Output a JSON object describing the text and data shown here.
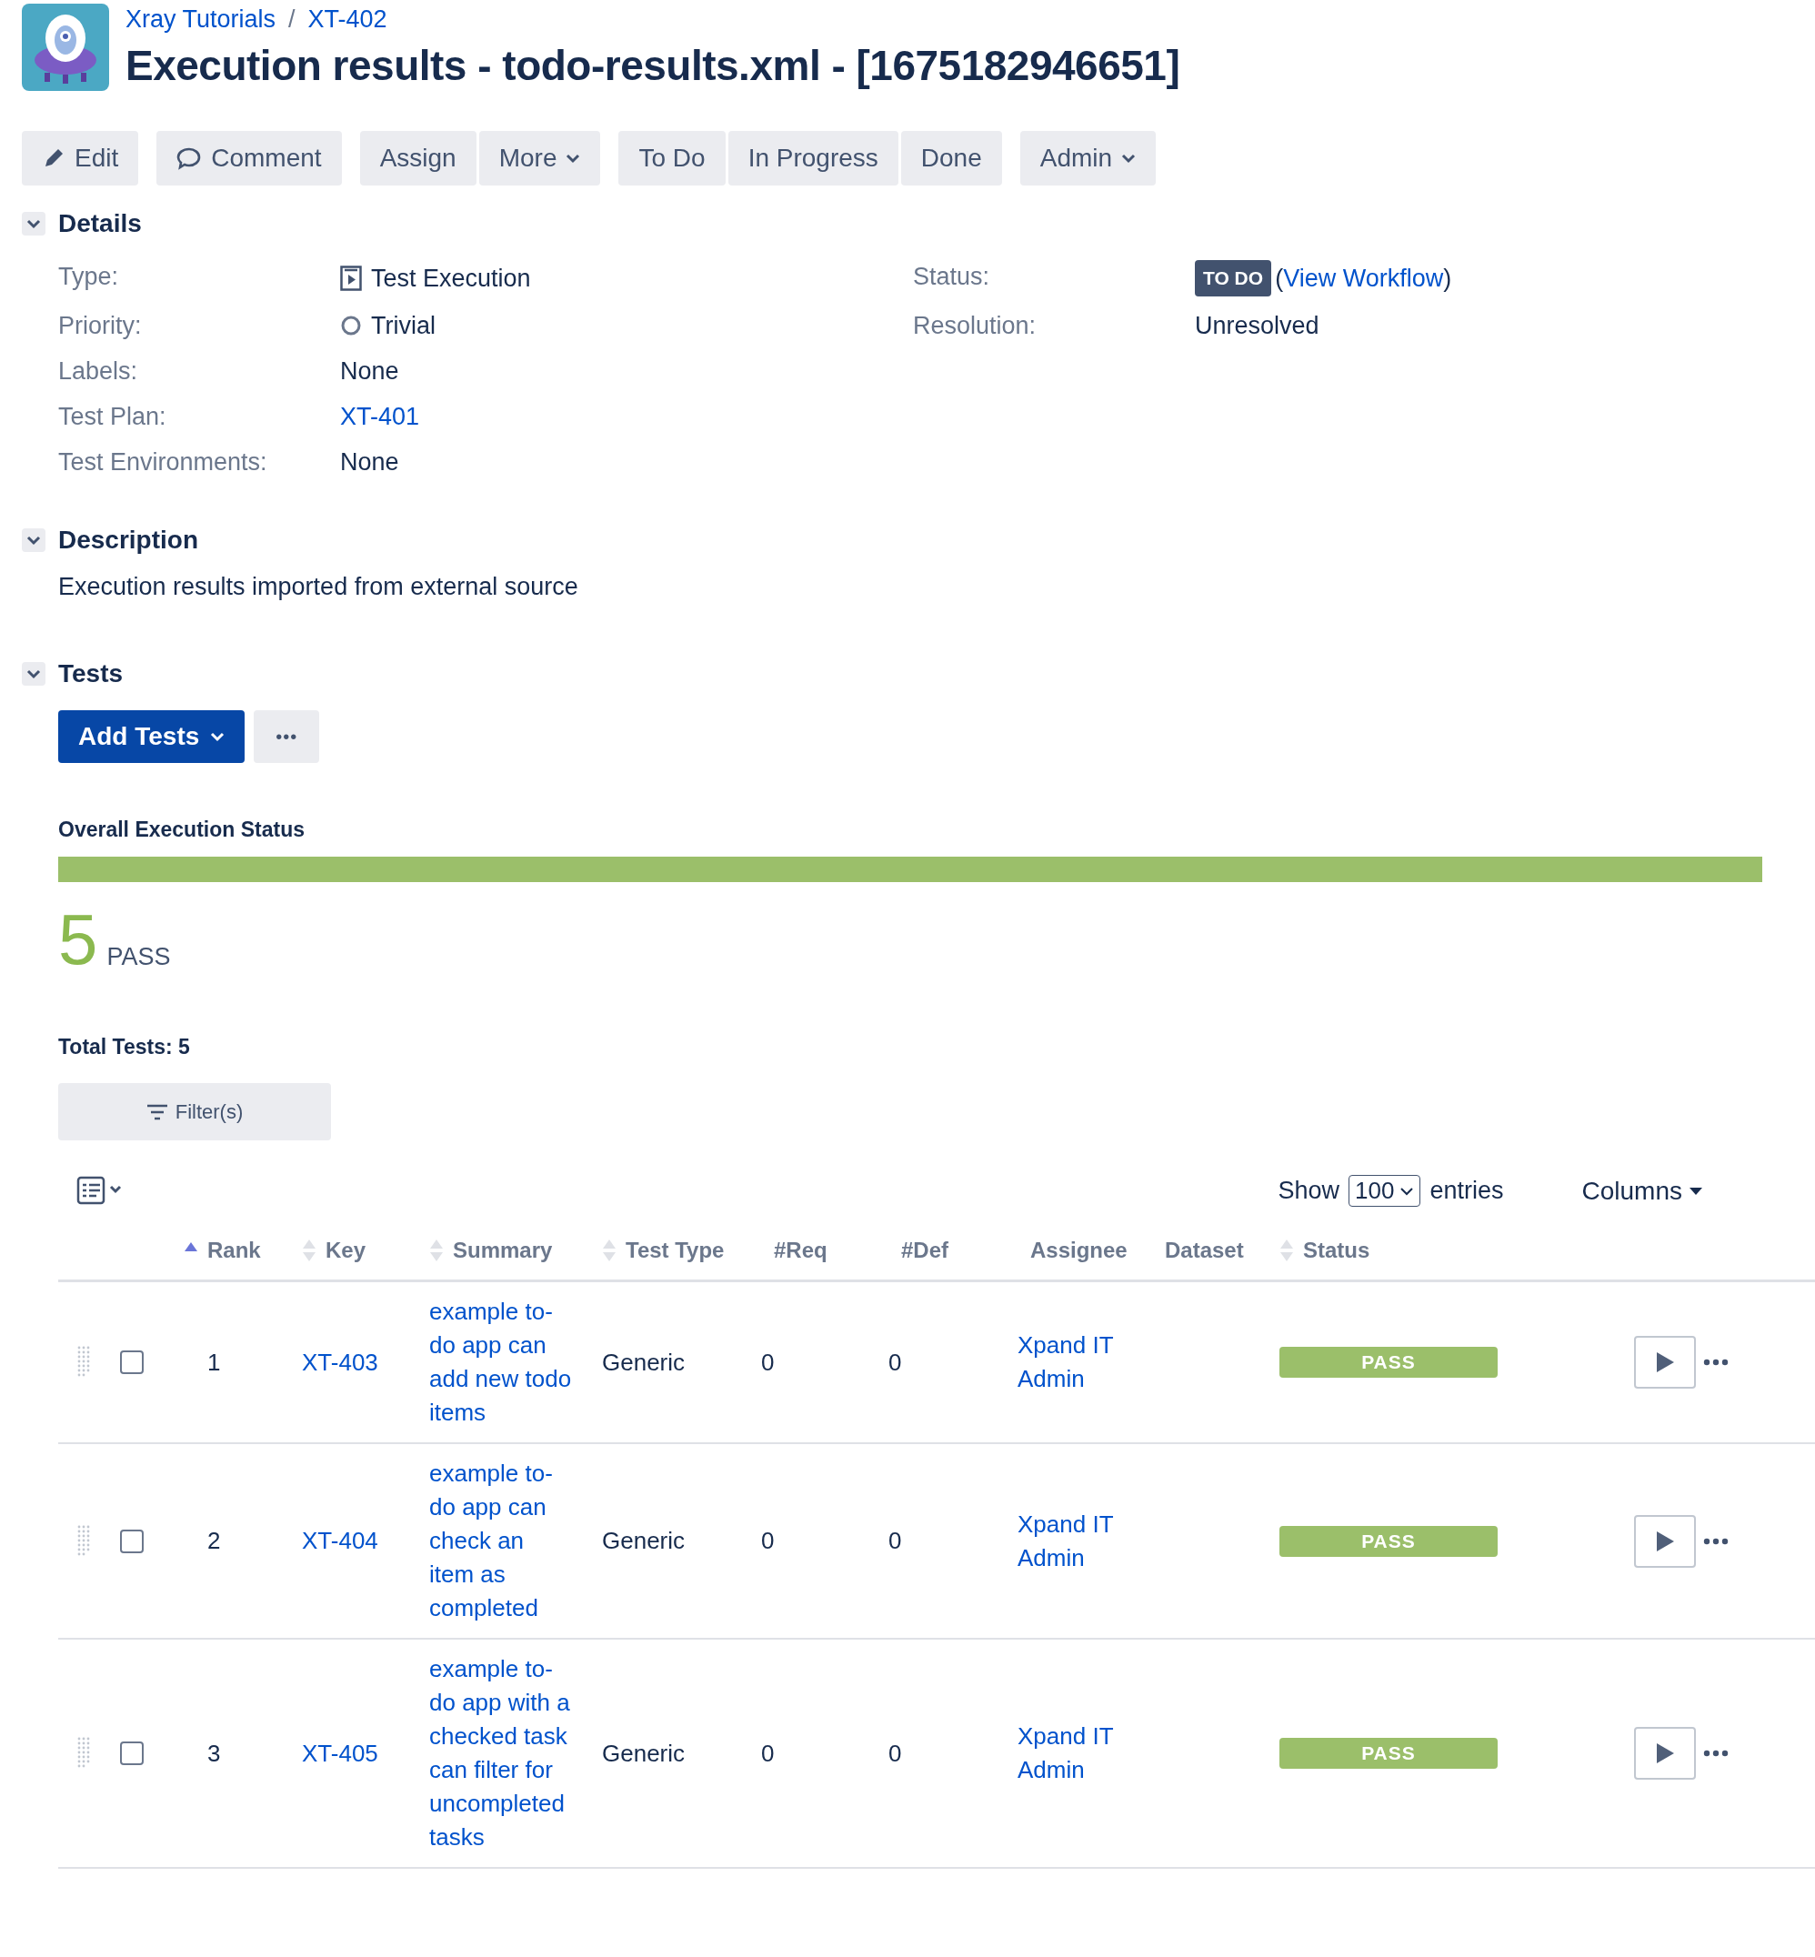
{
  "breadcrumbs": [
    {
      "kind": "link",
      "text": "Xray Tutorials"
    },
    {
      "kind": "separator",
      "text": "/"
    },
    {
      "kind": "link",
      "text": "XT-402"
    }
  ],
  "title": "Execution results - todo-results.xml - [1675182946651]",
  "toolbar": [
    {
      "group": [
        {
          "label": "Edit",
          "kind": "edit"
        }
      ]
    },
    {
      "group": [
        {
          "label": "Comment",
          "kind": "comment"
        }
      ]
    },
    {
      "group": [
        {
          "label": "Assign",
          "kind": "plain"
        },
        {
          "label": "More",
          "kind": "menu"
        }
      ]
    },
    {
      "group": [
        {
          "label": "To Do",
          "kind": "plain"
        },
        {
          "label": "In Progress",
          "kind": "plain"
        },
        {
          "label": "Done",
          "kind": "plain"
        }
      ]
    },
    {
      "group": [
        {
          "label": "Admin",
          "kind": "menu"
        }
      ]
    }
  ],
  "details": {
    "heading": "Details",
    "expanded": true,
    "left": [
      {
        "label": "Type:",
        "value": "Test Execution",
        "kind": "type"
      },
      {
        "label": "Priority:",
        "value": "Trivial",
        "kind": "priority"
      },
      {
        "label": "Labels:",
        "value": "None",
        "kind": "plain"
      },
      {
        "label": "Test Plan:",
        "value": "XT-401",
        "kind": "link"
      },
      {
        "label": "Test Environments:",
        "value": "None",
        "kind": "plain"
      }
    ],
    "right": [
      {
        "label": "Status:",
        "badge": "TO DO",
        "open": "(",
        "link": "View Workflow",
        "close": ")",
        "kind": "status"
      },
      {
        "label": "Resolution:",
        "value": "Unresolved",
        "kind": "plain"
      }
    ]
  },
  "description": {
    "heading": "Description",
    "expanded": true,
    "text": "Execution results imported from external source"
  },
  "tests": {
    "heading": "Tests",
    "expanded": true,
    "add_button": "Add Tests",
    "more_button": "•••",
    "overall": {
      "title": "Overall Execution Status",
      "level": 1,
      "count": "5",
      "label": "PASS"
    },
    "total": "Total Tests: 5",
    "filter_button": "Filter(s)",
    "show_label": "Show",
    "page_size": "100",
    "entries_label": "entries",
    "columns_button": "Columns",
    "columns": [
      {
        "label": "Rank",
        "sortable": true,
        "sorted": true
      },
      {
        "label": "Key",
        "sortable": true,
        "sorted": false
      },
      {
        "label": "Summary",
        "sortable": true,
        "sorted": false
      },
      {
        "label": "Test Type",
        "sortable": true,
        "sorted": false
      },
      {
        "label": "#Req",
        "sortable": false
      },
      {
        "label": "#Def",
        "sortable": false
      },
      {
        "label": "Assignee",
        "sortable": false
      },
      {
        "label": "Dataset",
        "sortable": false
      },
      {
        "label": "Status",
        "sortable": true,
        "sorted": false
      }
    ],
    "rows": [
      {
        "checked": false,
        "rank": "1",
        "key": "XT-403",
        "summary": "example to-do app can add new todo items",
        "test_type": "Generic",
        "req": "0",
        "def": "0",
        "assignee": "Xpand IT Admin",
        "status": "PASS"
      },
      {
        "checked": false,
        "rank": "2",
        "key": "XT-404",
        "summary": "example to-do app can check an item as completed",
        "test_type": "Generic",
        "req": "0",
        "def": "0",
        "assignee": "Xpand IT Admin",
        "status": "PASS"
      },
      {
        "checked": false,
        "rank": "3",
        "key": "XT-405",
        "summary": "example to-do app with a checked task can filter for uncompleted tasks",
        "test_type": "Generic",
        "req": "0",
        "def": "0",
        "assignee": "Xpand IT Admin",
        "status": "PASS"
      }
    ]
  }
}
